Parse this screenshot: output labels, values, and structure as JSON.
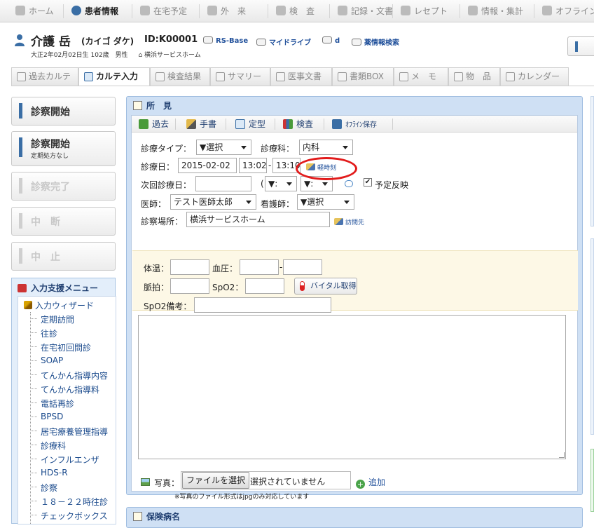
{
  "top_nav": [
    {
      "label": "ホーム",
      "icon": "home-icon",
      "active": false
    },
    {
      "label": "患者情報",
      "icon": "patients-icon",
      "active": true
    },
    {
      "label": "在宅予定",
      "icon": "clock-icon",
      "active": false
    },
    {
      "label": "外　来",
      "icon": "outpatient-icon",
      "active": false
    },
    {
      "label": "検　査",
      "icon": "test-icon",
      "active": false
    },
    {
      "label": "記録・文書",
      "icon": "record-icon",
      "active": false
    },
    {
      "label": "レセプト",
      "icon": "receipt-icon",
      "active": false
    },
    {
      "label": "情報・集計",
      "icon": "stats-icon",
      "active": false
    },
    {
      "label": "オフライン",
      "icon": "offline-icon",
      "active": false
    }
  ],
  "patient": {
    "name": "介護 岳",
    "kana": "(カイゴ ダケ)",
    "id": "ID:K00001",
    "links": [
      "RS-Base",
      "マイドライブ",
      "d",
      "薬情報検索"
    ],
    "birth": "大正2年02月02日生 102歳",
    "sex": "男性",
    "facility": "横浜サービスホーム"
  },
  "tabs": [
    {
      "label": "過去カルテ",
      "active": false
    },
    {
      "label": "カルテ入力",
      "active": true
    },
    {
      "label": "検査結果",
      "active": false
    },
    {
      "label": "サマリー",
      "active": false
    },
    {
      "label": "医事文書",
      "active": false
    },
    {
      "label": "書類BOX",
      "active": false
    },
    {
      "label": "メ　モ",
      "active": false
    },
    {
      "label": "物　品",
      "active": false
    },
    {
      "label": "カレンダー",
      "active": false
    }
  ],
  "side_buttons": {
    "start": "診察開始",
    "start_nodose": "診察開始",
    "start_nodose_sub": "定期処方なし",
    "complete": "診察完了",
    "interrupt": "中　断",
    "cancel": "中　止"
  },
  "assist_menu": {
    "title": "入力支援メニュー",
    "wizard": "入力ウィザード",
    "items": [
      "定期訪問",
      "往診",
      "在宅初回問診",
      "SOAP",
      "てんかん指導内容",
      "てんかん指導料",
      "電話再診",
      "BPSD",
      "居宅療養管理指導",
      "診療科",
      "インフルエンザ",
      "HDS-R",
      "診察",
      "１８－２２時往診",
      "チェックボックス"
    ]
  },
  "findings": {
    "title": "所　見",
    "toolbar": [
      "過去",
      "手書",
      "定型",
      "検査",
      "ｵﾌﾗｲﾝ保存"
    ],
    "visit_type_label": "診療タイプ：",
    "visit_type_value": "▼選択",
    "dept_label": "診療科：",
    "dept_value": "内科",
    "date_label": "診療日：",
    "date_value": "2015-02-02",
    "time_start": "13:02",
    "time_dash": "-",
    "time_end": "13:10",
    "light_time_link": "軽時刻",
    "next_date_label": "次回診療日：",
    "next_date_value": "",
    "next_paren": "(",
    "next_hour": "▼:",
    "next_min": "▼:",
    "schedule_reflect": "予定反映",
    "doctor_label": "医師：",
    "doctor_value": "テスト医師太郎",
    "nurse_label": "看護師：",
    "nurse_value": "▼選択",
    "place_label": "診察場所：",
    "place_value": "横浜サービスホーム",
    "visit_dest_link": "訪問先",
    "temp_label": "体温：",
    "bp_label": "血圧：",
    "bp_dash": "-",
    "pulse_label": "脈拍：",
    "spo2_label": "SpO2：",
    "vital_button": "バイタル取得",
    "spo2_note_label": "SpO2備考：",
    "photo_label": "写真：",
    "file_button": "ファイルを選択",
    "file_status": "選択されていません",
    "add_label": "追加",
    "photo_note": "※写真のファイル形式はjpgのみ対応しています"
  },
  "insurance_panel_title": "保険病名",
  "colors": {
    "accent": "#3a6ea5",
    "panel": "#cfe0f4",
    "vitals_bg": "#fdf8e6",
    "highlight": "#e21b1b"
  }
}
